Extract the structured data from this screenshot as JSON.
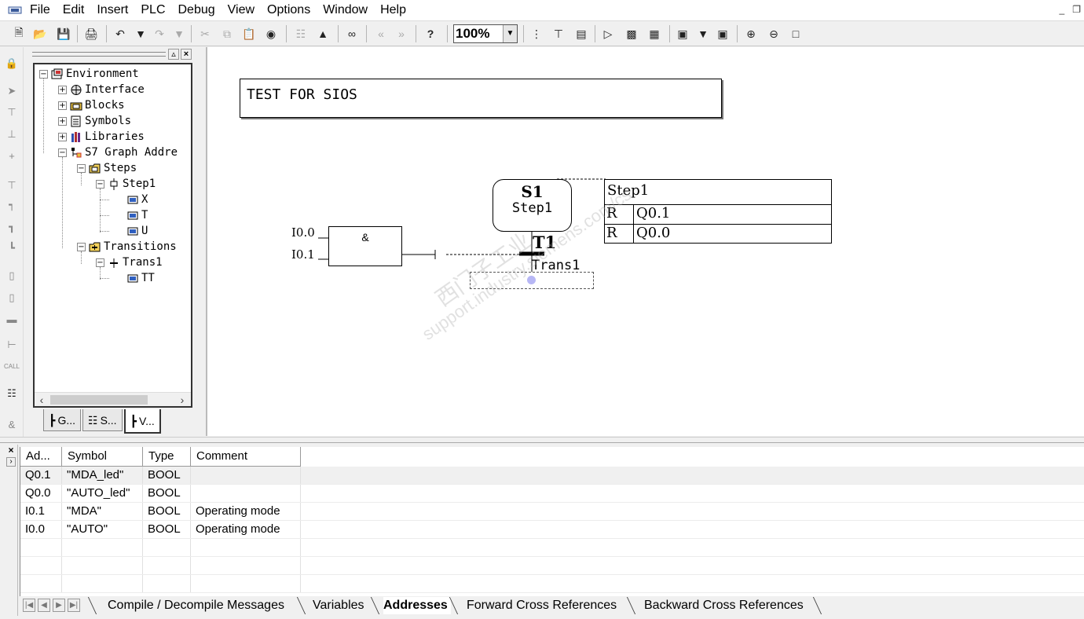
{
  "menu": {
    "items": [
      "File",
      "Edit",
      "Insert",
      "PLC",
      "Debug",
      "View",
      "Options",
      "Window",
      "Help"
    ],
    "window_buttons": [
      "_",
      "❐"
    ]
  },
  "toolbar": {
    "zoom": "100%",
    "icons": [
      "new-icon",
      "open-icon",
      "save-icon",
      "print-icon",
      "undo-icon",
      "undo-dropdown-icon",
      "redo-icon",
      "redo-dropdown-icon",
      "cut-icon",
      "copy-icon",
      "paste-icon",
      "find-icon",
      "network-icon",
      "download-icon",
      "monitor-icon",
      "prev-icon",
      "next-icon",
      "help-icon",
      "step-icon",
      "transition-icon",
      "branch-icon",
      "jump-icon",
      "simultaneous-icon",
      "alternative-icon",
      "display-icon",
      "display-dropdown-icon",
      "overview-icon",
      "zoom-in-icon",
      "zoom-out-icon",
      "fit-icon"
    ]
  },
  "tree": {
    "items": [
      {
        "label": "Environment",
        "icon": "environment-icon",
        "level": 0,
        "expander": "-"
      },
      {
        "label": "Interface",
        "icon": "interface-icon",
        "level": 1,
        "expander": "+"
      },
      {
        "label": "Blocks",
        "icon": "blocks-icon",
        "level": 1,
        "expander": "+"
      },
      {
        "label": "Symbols",
        "icon": "symbols-icon",
        "level": 1,
        "expander": "+"
      },
      {
        "label": "Libraries",
        "icon": "libraries-icon",
        "level": 1,
        "expander": "+"
      },
      {
        "label": "S7 Graph Addre",
        "icon": "graph-address-icon",
        "level": 1,
        "expander": "-"
      },
      {
        "label": "Steps",
        "icon": "folder-icon",
        "level": 2,
        "expander": "-"
      },
      {
        "label": "Step1",
        "icon": "step-icon",
        "level": 3,
        "expander": "-"
      },
      {
        "label": "X",
        "icon": "address-icon",
        "level": 4,
        "expander": ""
      },
      {
        "label": "T",
        "icon": "address-icon",
        "level": 4,
        "expander": ""
      },
      {
        "label": "U",
        "icon": "address-icon",
        "level": 4,
        "expander": ""
      },
      {
        "label": "Transitions",
        "icon": "folder-icon",
        "level": 2,
        "expander": "-"
      },
      {
        "label": "Trans1",
        "icon": "transition-icon",
        "level": 3,
        "expander": "-"
      },
      {
        "label": "TT",
        "icon": "address-icon",
        "level": 4,
        "expander": ""
      }
    ],
    "tabs": [
      {
        "label": "G...",
        "icon": "graph-tab-icon"
      },
      {
        "label": "S...",
        "icon": "sequence-tab-icon"
      },
      {
        "label": "V...",
        "icon": "variables-tab-icon"
      }
    ]
  },
  "editor": {
    "comment": "TEST FOR SIOS",
    "step": {
      "number": "S1",
      "name": "Step1"
    },
    "actions": {
      "title": "Step1",
      "rows": [
        {
          "qualifier": "R",
          "address": "Q0.1"
        },
        {
          "qualifier": "R",
          "address": "Q0.0"
        }
      ]
    },
    "and_block": "&",
    "inputs": [
      "I0.0",
      "I0.1"
    ],
    "transition": {
      "number": "T1",
      "name": "Trans1"
    },
    "watermark": [
      "西门子工业",
      "support.industry.siemens.com/cs"
    ]
  },
  "details": {
    "columns": [
      "Ad...",
      "Symbol",
      "Type",
      "Comment"
    ],
    "rows": [
      [
        "Q0.1",
        "\"MDA_led\"",
        "BOOL",
        ""
      ],
      [
        "Q0.0",
        "\"AUTO_led\"",
        "BOOL",
        ""
      ],
      [
        "I0.1",
        "\"MDA\"",
        "BOOL",
        "Operating mode"
      ],
      [
        "I0.0",
        "\"AUTO\"",
        "BOOL",
        "Operating mode"
      ]
    ],
    "tabs": [
      "Compile / Decompile Messages",
      "Variables",
      "Addresses",
      "Forward Cross References",
      "Backward Cross References"
    ],
    "active_tab": "Addresses"
  }
}
